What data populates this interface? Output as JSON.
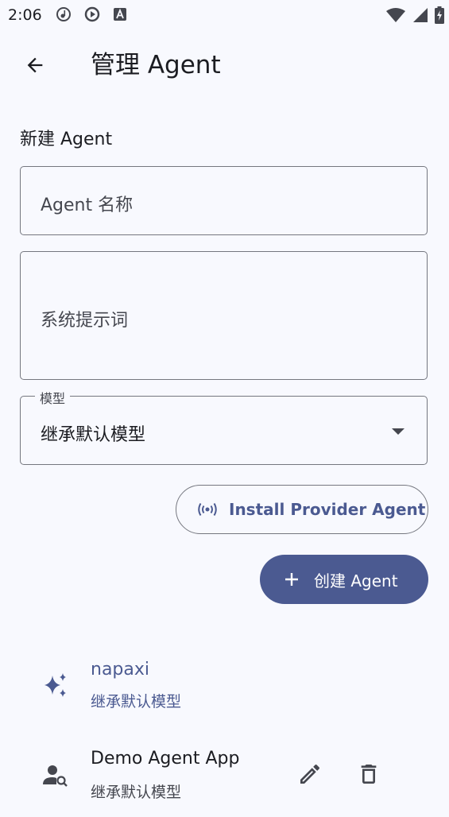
{
  "status_bar": {
    "time": "2:06"
  },
  "app_bar": {
    "title": "管理 Agent"
  },
  "form": {
    "section_title": "新建 Agent",
    "name_placeholder": "Agent 名称",
    "prompt_placeholder": "系统提示词",
    "model_label": "模型",
    "model_value": "继承默认模型",
    "install_button_label": "Install Provider Agent",
    "create_button_label": "创建 Agent"
  },
  "agents": [
    {
      "name": "napaxi",
      "model": "继承默认模型",
      "icon": "sparkle-icon"
    },
    {
      "name": "Demo Agent App",
      "model": "继承默认模型",
      "icon": "person-search-icon"
    }
  ],
  "colors": {
    "primary": "#4b5a91",
    "background": "#f8f9fe",
    "outline": "#75777f"
  }
}
